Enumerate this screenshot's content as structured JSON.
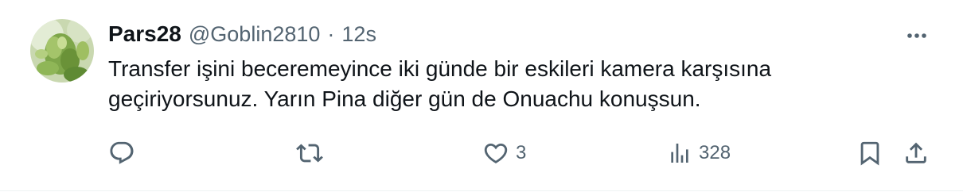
{
  "tweet": {
    "display_name": "Pars28",
    "handle": "@Goblin2810",
    "separator": "·",
    "time": "12s",
    "text": "Transfer işini beceremeyince iki günde bir eskileri kamera karşısına geçiriyorsunuz. Yarın Pina diğer gün de Onuachu konuşsun."
  },
  "actions": {
    "reply_count": "",
    "repost_count": "",
    "like_count": "3",
    "views_count": "328"
  },
  "icons": {
    "reply": "reply-icon",
    "repost": "repost-icon",
    "like": "heart-icon",
    "views": "views-icon",
    "bookmark": "bookmark-icon",
    "share": "share-icon",
    "more": "more-icon"
  },
  "colors": {
    "text_primary": "#0f1419",
    "text_secondary": "#536471",
    "divider": "#eff3f4"
  }
}
